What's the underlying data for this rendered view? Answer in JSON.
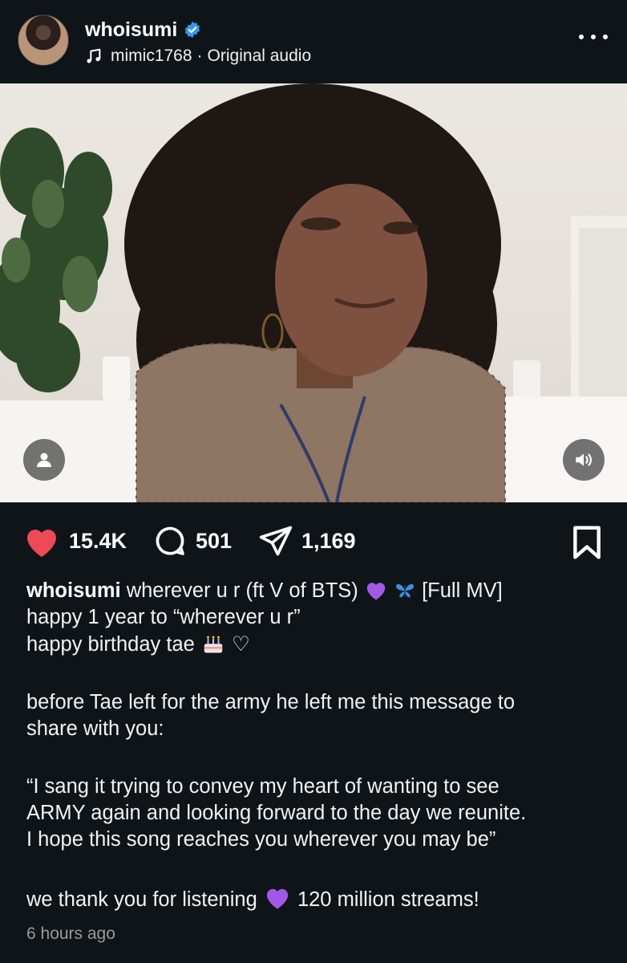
{
  "header": {
    "username": "whoisumi",
    "audio_source": "mimic1768",
    "audio_separator": "·",
    "audio_label": "Original audio",
    "icons": [
      "verified-badge-icon",
      "music-note-icon",
      "more-options-icon"
    ]
  },
  "media": {
    "icons": [
      "user-tag-icon",
      "volume-icon"
    ]
  },
  "actions": {
    "likes": "15.4K",
    "comments": "501",
    "shares": "1,169",
    "icons": [
      "heart-icon",
      "comment-icon",
      "share-icon",
      "bookmark-icon"
    ],
    "like_color": "#ed4956"
  },
  "caption": {
    "username": "whoisumi",
    "line1_text": "wherever u r (ft V of BTS)",
    "line1_end": "[Full MV]",
    "line2": "happy 1 year to “wherever u r”",
    "line3": "happy birthday tae",
    "line3_end": "♡",
    "para2_line1": "before Tae left for the army he left me this message to",
    "para2_line2": "share with you:",
    "quote_line1": "“I sang it trying to convey my heart of wanting to see",
    "quote_line2": "ARMY again and looking forward to the day we reunite.",
    "quote_line3": "I hope this song reaches you wherever you may be”",
    "final_start": "we thank you for listening",
    "final_end": "120 million streams!",
    "emoji_names": [
      "purple-heart",
      "blue-butterfly",
      "birthday-cake",
      "purple-heart"
    ]
  },
  "timestamp": "6 hours ago"
}
